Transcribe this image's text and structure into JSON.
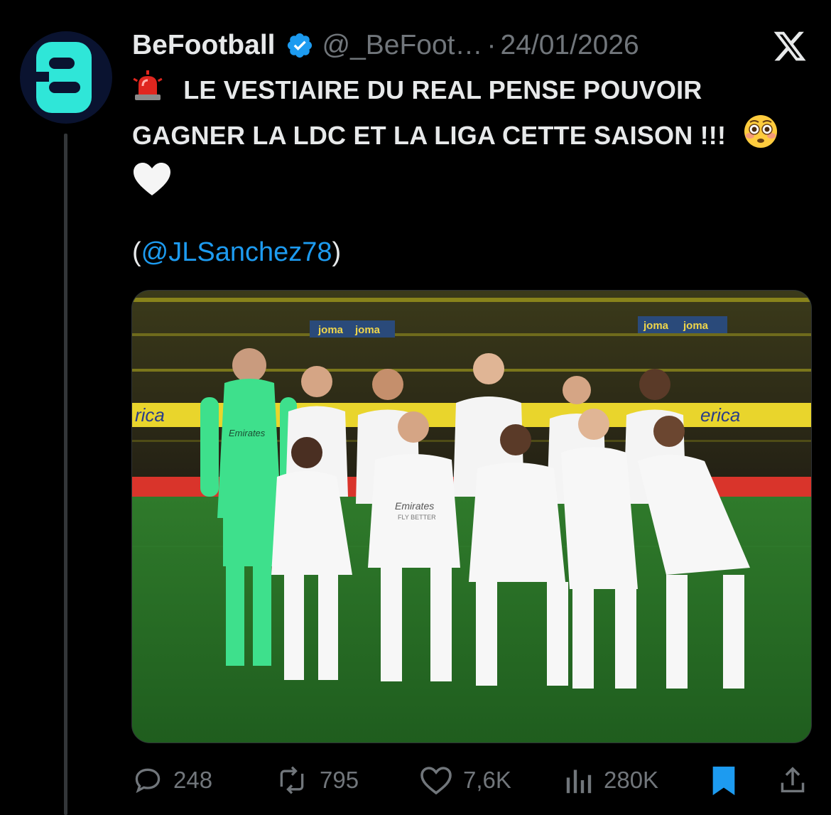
{
  "tweet": {
    "author_name": "BeFootball",
    "handle": "@_BeFoot…",
    "separator": "·",
    "date": "24/01/2026",
    "text_line1": "LE VESTIAIRE DU REAL PENSE POUVOIR",
    "text_line2": "GAGNER LA LDC ET LA LIGA CETTE SAISON !!!",
    "mention_open": "(",
    "mention": "@JLSanchez78",
    "mention_close": ")",
    "emojis": [
      "rotating-light-icon",
      "flushed-face-icon",
      "white-heart-icon"
    ]
  },
  "media": {
    "stadium_boards": [
      "joma",
      "joma",
      "joma",
      "joma"
    ],
    "side_board_left": "rica",
    "side_board_right": "erica",
    "sponsor_text": "Emirates",
    "sponsor_subtext": "FLY BETTER"
  },
  "actions": {
    "replies": "248",
    "reposts": "795",
    "likes": "7,6K",
    "views": "280K"
  },
  "colors": {
    "background": "#000000",
    "text": "#e7e9ea",
    "muted": "#71767b",
    "link": "#1d9bf0",
    "bookmark_active": "#1d9bf0",
    "avatar_accent": "#2fe6d8"
  }
}
